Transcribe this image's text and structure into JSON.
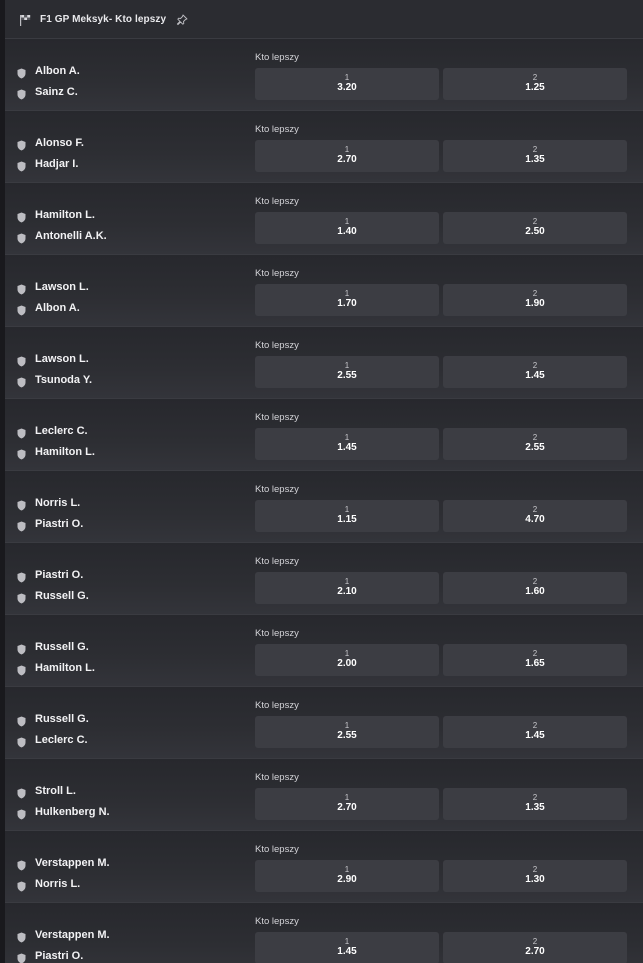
{
  "header": {
    "title": "F1 GP Meksyk- Kto lepszy",
    "flag_icon": "checkered-flag-icon",
    "pin_icon": "pin-icon"
  },
  "events": [
    {
      "p1": "Albon A.",
      "p2": "Sainz C.",
      "market": "Kto lepszy",
      "sel1": "1",
      "odd1": "3.20",
      "sel2": "2",
      "odd2": "1.25"
    },
    {
      "p1": "Alonso F.",
      "p2": "Hadjar I.",
      "market": "Kto lepszy",
      "sel1": "1",
      "odd1": "2.70",
      "sel2": "2",
      "odd2": "1.35"
    },
    {
      "p1": "Hamilton L.",
      "p2": "Antonelli A.K.",
      "market": "Kto lepszy",
      "sel1": "1",
      "odd1": "1.40",
      "sel2": "2",
      "odd2": "2.50"
    },
    {
      "p1": "Lawson L.",
      "p2": "Albon A.",
      "market": "Kto lepszy",
      "sel1": "1",
      "odd1": "1.70",
      "sel2": "2",
      "odd2": "1.90"
    },
    {
      "p1": "Lawson L.",
      "p2": "Tsunoda Y.",
      "market": "Kto lepszy",
      "sel1": "1",
      "odd1": "2.55",
      "sel2": "2",
      "odd2": "1.45"
    },
    {
      "p1": "Leclerc C.",
      "p2": "Hamilton L.",
      "market": "Kto lepszy",
      "sel1": "1",
      "odd1": "1.45",
      "sel2": "2",
      "odd2": "2.55"
    },
    {
      "p1": "Norris L.",
      "p2": "Piastri O.",
      "market": "Kto lepszy",
      "sel1": "1",
      "odd1": "1.15",
      "sel2": "2",
      "odd2": "4.70"
    },
    {
      "p1": "Piastri O.",
      "p2": "Russell G.",
      "market": "Kto lepszy",
      "sel1": "1",
      "odd1": "2.10",
      "sel2": "2",
      "odd2": "1.60"
    },
    {
      "p1": "Russell G.",
      "p2": "Hamilton L.",
      "market": "Kto lepszy",
      "sel1": "1",
      "odd1": "2.00",
      "sel2": "2",
      "odd2": "1.65"
    },
    {
      "p1": "Russell G.",
      "p2": "Leclerc C.",
      "market": "Kto lepszy",
      "sel1": "1",
      "odd1": "2.55",
      "sel2": "2",
      "odd2": "1.45"
    },
    {
      "p1": "Stroll L.",
      "p2": "Hulkenberg N.",
      "market": "Kto lepszy",
      "sel1": "1",
      "odd1": "2.70",
      "sel2": "2",
      "odd2": "1.35"
    },
    {
      "p1": "Verstappen M.",
      "p2": "Norris L.",
      "market": "Kto lepszy",
      "sel1": "1",
      "odd1": "2.90",
      "sel2": "2",
      "odd2": "1.30"
    },
    {
      "p1": "Verstappen M.",
      "p2": "Piastri O.",
      "market": "Kto lepszy",
      "sel1": "1",
      "odd1": "1.45",
      "sel2": "2",
      "odd2": "2.70"
    }
  ],
  "colors": {
    "page_bg": "#1b1c20",
    "header_bg": "#2b2c31",
    "row_bg": "#2d2e33",
    "odd_button_bg": "#3c3d43",
    "text": "#ffffff",
    "icon": "#bdbdc2"
  }
}
